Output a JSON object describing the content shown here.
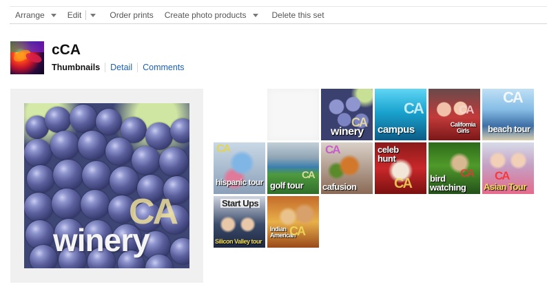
{
  "toolbar": {
    "arrange": "Arrange",
    "edit": "Edit",
    "order_prints": "Order prints",
    "create_products": "Create photo products",
    "delete_set": "Delete this set"
  },
  "set": {
    "title": "cCA",
    "tabs": {
      "thumbnails": "Thumbnails",
      "detail": "Detail",
      "comments": "Comments"
    }
  },
  "preview": {
    "caption": "winery",
    "badge": "CA"
  },
  "thumbs": [
    {
      "caption": "",
      "badge": ""
    },
    {
      "caption": "",
      "badge": ""
    },
    {
      "caption": "winery",
      "badge": "CA"
    },
    {
      "caption": "campus",
      "badge": "CA"
    },
    {
      "caption": "California Girls",
      "badge": "CA"
    },
    {
      "caption": "beach tour",
      "badge": "CA"
    },
    {
      "caption": "hispanic tour",
      "badge": "CA"
    },
    {
      "caption": "golf tour",
      "badge": "CA"
    },
    {
      "caption": "cafusion",
      "badge": "CA"
    },
    {
      "caption": "celeb hunt",
      "badge": "CA"
    },
    {
      "caption": "bird watching",
      "badge": "CA"
    },
    {
      "caption": "Asian Tour",
      "badge": "CA"
    },
    {
      "caption": "Start Ups",
      "subcaption": "Silicon Valley tour",
      "badge": ""
    },
    {
      "caption": "Indian American",
      "badge": "CA"
    }
  ]
}
